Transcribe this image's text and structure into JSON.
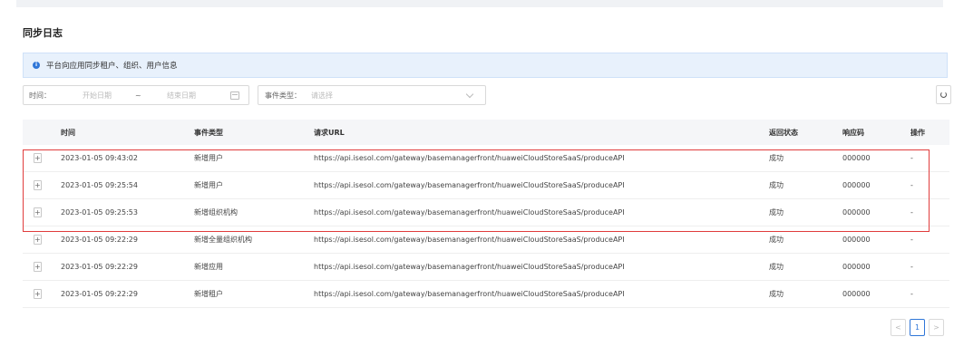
{
  "page": {
    "title": "同步日志"
  },
  "alert": {
    "text": "平台向应用同步租户、组织、用户信息"
  },
  "filters": {
    "time_label": "时间：",
    "start_placeholder": "开始日期",
    "separator": "~",
    "end_placeholder": "结束日期",
    "event_type_label": "事件类型：",
    "event_type_placeholder": "请选择"
  },
  "table": {
    "headers": [
      "时间",
      "事件类型",
      "请求URL",
      "返回状态",
      "响应码",
      "操作"
    ],
    "rows": [
      {
        "time": "2023-01-05 09:43:02",
        "event": "新增用户",
        "url": "https://api.isesol.com/gateway/basemanagerfront/huaweiCloudStoreSaaS/produceAPI",
        "status": "成功",
        "code": "000000",
        "action": "-"
      },
      {
        "time": "2023-01-05 09:25:54",
        "event": "新增用户",
        "url": "https://api.isesol.com/gateway/basemanagerfront/huaweiCloudStoreSaaS/produceAPI",
        "status": "成功",
        "code": "000000",
        "action": "-"
      },
      {
        "time": "2023-01-05 09:25:53",
        "event": "新增组织机构",
        "url": "https://api.isesol.com/gateway/basemanagerfront/huaweiCloudStoreSaaS/produceAPI",
        "status": "成功",
        "code": "000000",
        "action": "-"
      },
      {
        "time": "2023-01-05 09:22:29",
        "event": "新增全量组织机构",
        "url": "https://api.isesol.com/gateway/basemanagerfront/huaweiCloudStoreSaaS/produceAPI",
        "status": "成功",
        "code": "000000",
        "action": "-"
      },
      {
        "time": "2023-01-05 09:22:29",
        "event": "新增应用",
        "url": "https://api.isesol.com/gateway/basemanagerfront/huaweiCloudStoreSaaS/produceAPI",
        "status": "成功",
        "code": "000000",
        "action": "-"
      },
      {
        "time": "2023-01-05 09:22:29",
        "event": "新增租户",
        "url": "https://api.isesol.com/gateway/basemanagerfront/huaweiCloudStoreSaaS/produceAPI",
        "status": "成功",
        "code": "000000",
        "action": "-"
      }
    ],
    "expand_symbol": "+"
  },
  "pagination": {
    "prev": "<",
    "current": "1",
    "next": ">"
  },
  "colors": {
    "accent": "#2f76d8",
    "highlight_border": "#e03c3c",
    "alert_bg": "#e8f1fc"
  }
}
